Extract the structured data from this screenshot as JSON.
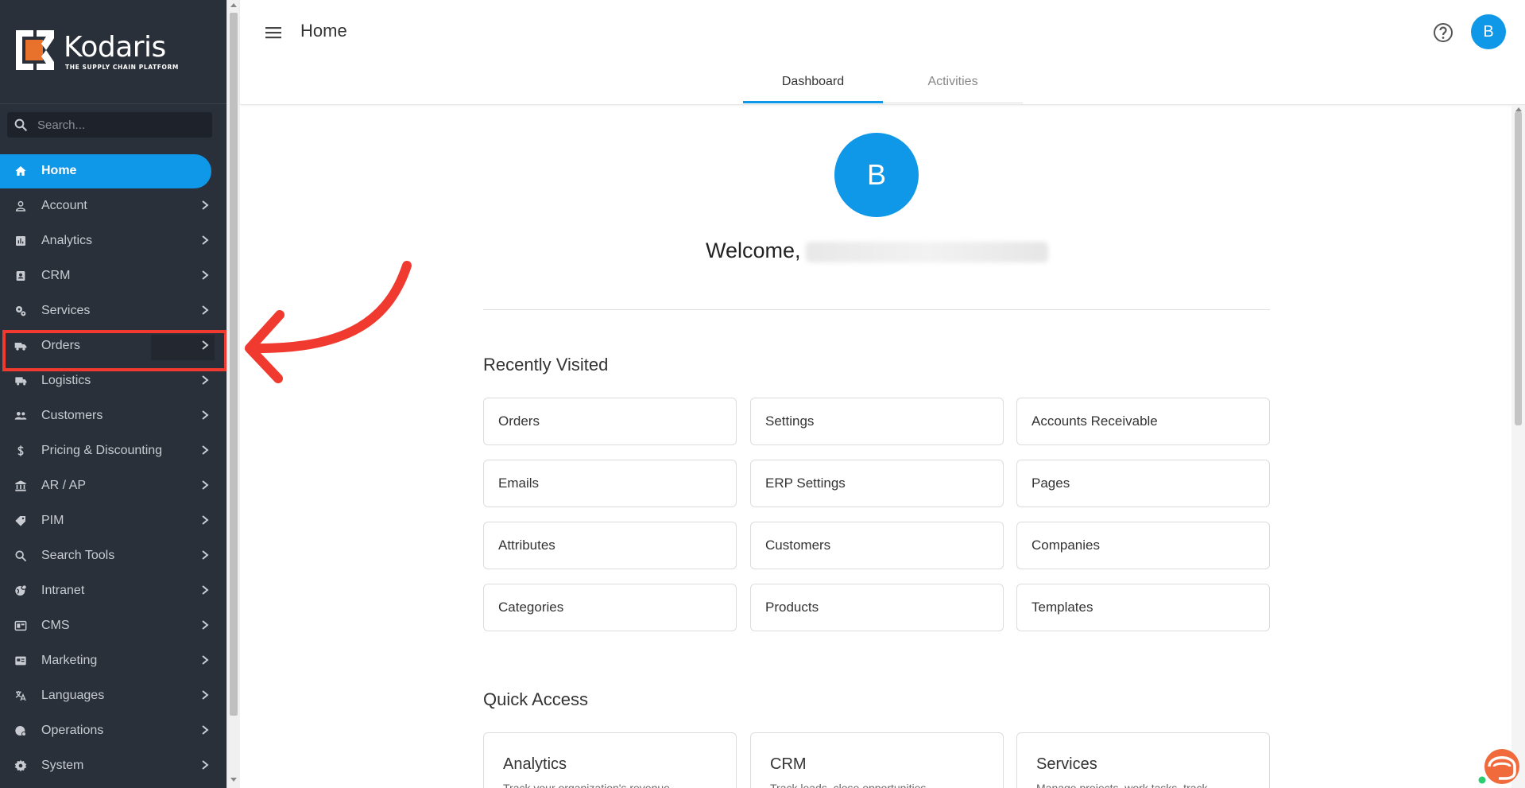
{
  "brand": {
    "name": "Kodaris",
    "tagline": "THE SUPPLY CHAIN PLATFORM",
    "colors": {
      "accent": "#0f97e8",
      "sidebar": "#2a303a",
      "logo_orange": "#e8712c",
      "annotation": "#f03a2f"
    }
  },
  "search": {
    "placeholder": "Search..."
  },
  "sidebar": {
    "items": [
      {
        "label": "Home",
        "icon": "home-icon"
      },
      {
        "label": "Account",
        "icon": "person-icon"
      },
      {
        "label": "Analytics",
        "icon": "analytics-icon"
      },
      {
        "label": "CRM",
        "icon": "contacts-icon"
      },
      {
        "label": "Services",
        "icon": "gears-icon"
      },
      {
        "label": "Orders",
        "icon": "truck-icon"
      },
      {
        "label": "Logistics",
        "icon": "delivery-icon"
      },
      {
        "label": "Customers",
        "icon": "people-icon"
      },
      {
        "label": "Pricing & Discounting",
        "icon": "dollar-icon"
      },
      {
        "label": "AR / AP",
        "icon": "bank-icon"
      },
      {
        "label": "PIM",
        "icon": "tag-icon"
      },
      {
        "label": "Search Tools",
        "icon": "search-icon"
      },
      {
        "label": "Intranet",
        "icon": "globe-icon"
      },
      {
        "label": "CMS",
        "icon": "cms-icon"
      },
      {
        "label": "Marketing",
        "icon": "campaign-icon"
      },
      {
        "label": "Languages",
        "icon": "translate-icon"
      },
      {
        "label": "Operations",
        "icon": "operations-icon"
      },
      {
        "label": "System",
        "icon": "gear-icon"
      }
    ]
  },
  "header": {
    "title": "Home",
    "avatar_initial": "B",
    "tabs": [
      {
        "label": "Dashboard"
      },
      {
        "label": "Activities"
      }
    ]
  },
  "main": {
    "avatar_initial": "B",
    "welcome": "Welcome,",
    "recent_title": "Recently Visited",
    "recent": [
      "Orders",
      "Settings",
      "Accounts Receivable",
      "Emails",
      "ERP Settings",
      "Pages",
      "Attributes",
      "Customers",
      "Companies",
      "Categories",
      "Products",
      "Templates"
    ],
    "quick_title": "Quick Access",
    "quick": [
      {
        "title": "Analytics",
        "desc": "Track your organization's revenue..."
      },
      {
        "title": "CRM",
        "desc": "Track leads, close opportunities..."
      },
      {
        "title": "Services",
        "desc": "Manage projects, work tasks, track..."
      }
    ]
  }
}
